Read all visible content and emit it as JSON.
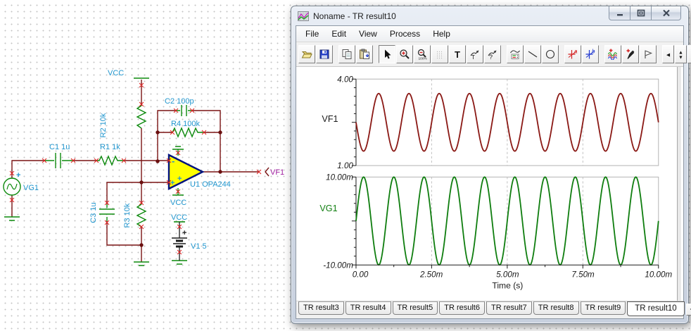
{
  "window": {
    "title": "Noname - TR result10",
    "controls": {
      "minimize": "minimize",
      "restore": "restore",
      "close": "close"
    }
  },
  "menu": {
    "items": [
      "File",
      "Edit",
      "View",
      "Process",
      "Help"
    ]
  },
  "toolbar": {
    "groups": [
      [
        "open",
        "save"
      ],
      [
        "copy",
        "paste"
      ],
      [
        "select-cursor",
        "zoom-in",
        "zoom-out-100",
        "grid",
        "text",
        "annotate-text",
        "annotate-question"
      ],
      [
        "legend",
        "line-tool",
        "ellipse-tool"
      ],
      [
        "cursor-a",
        "cursor-b"
      ],
      [
        "add-curves",
        "probe",
        "marker"
      ]
    ],
    "nav_group": [
      "nav-left",
      "nav-spinner",
      "nav-right"
    ]
  },
  "tabs": {
    "items": [
      "TR result3",
      "TR result4",
      "TR result5",
      "TR result6",
      "TR result7",
      "TR result8",
      "TR result9",
      "TR result10"
    ],
    "active": "TR result10",
    "scroll_buttons": [
      "tab-scroll-left",
      "tab-scroll-right"
    ]
  },
  "chart_data": {
    "type": "line",
    "xlabel": "Time (s)",
    "x_range_s": [
      0,
      0.01
    ],
    "x_ticks": [
      {
        "value": 0.0,
        "label": "0.00",
        "grid": false
      },
      {
        "value": 0.0025,
        "label": "2.50m",
        "grid": true
      },
      {
        "value": 0.005,
        "label": "5.00m",
        "grid": true
      },
      {
        "value": 0.0075,
        "label": "7.50m",
        "grid": true
      },
      {
        "value": 0.01,
        "label": "10.00m",
        "grid": false
      }
    ],
    "x_minor_tick_interval": 0.00125,
    "legend_position": "left-of-axis",
    "grid_style": "dashed-vertical",
    "panels": [
      {
        "signal": "VF1",
        "color": "#8b1a16",
        "label_color": "#1a1a1a",
        "ylim": [
          1.0,
          4.0
        ],
        "y_major_ticks": [
          {
            "value": 4.0,
            "label": "4.00"
          },
          {
            "value": 2.5,
            "label": ""
          },
          {
            "value": 1.0,
            "label": "1.00"
          }
        ],
        "y_minor_ticks": [
          1.3,
          1.6,
          1.9,
          2.2,
          2.8,
          3.1,
          3.4,
          3.7
        ],
        "waveform": {
          "shape": "sine",
          "frequency_hz": 1000,
          "amplitude": 1.0,
          "offset": 2.5,
          "phase_deg": 180,
          "cycles_shown": 10
        }
      },
      {
        "signal": "VG1",
        "color": "#107e10",
        "label_color": "#107e10",
        "ylim": [
          -0.01,
          0.01
        ],
        "y_major_ticks": [
          {
            "value": 0.01,
            "label": "10.00m"
          },
          {
            "value": 0.0,
            "label": ""
          },
          {
            "value": -0.01,
            "label": "-10.00m"
          }
        ],
        "y_minor_ticks": [
          -0.008,
          -0.006,
          -0.004,
          -0.002,
          0.002,
          0.004,
          0.006,
          0.008
        ],
        "waveform": {
          "shape": "sine",
          "frequency_hz": 1000,
          "amplitude": 0.01,
          "offset": 0,
          "phase_deg": 0,
          "cycles_shown": 10
        }
      }
    ]
  },
  "circuit": {
    "labels": {
      "vg1": "VG1",
      "c1": "C1 1u",
      "r1": "R1 1k",
      "vcc": "VCC",
      "r2": "R2 10k",
      "c2": "C2 100p",
      "r4": "R4 100k",
      "c3": "C3 1u",
      "r3": "R3 10k",
      "u1": "U1 OPA244",
      "v1": "V1 5",
      "vf1": "VF1"
    },
    "marks": {
      "plus": "+",
      "minus": "-"
    },
    "colors": {
      "wire": "#7a1414",
      "component": "#0d8a0d",
      "label": "#2196ce",
      "net_label": "#a020a0",
      "junction": "#6b1010",
      "pin_mark": "#e02020",
      "opamp_fill": "#ffff00",
      "opamp_border": "#00127e"
    }
  }
}
